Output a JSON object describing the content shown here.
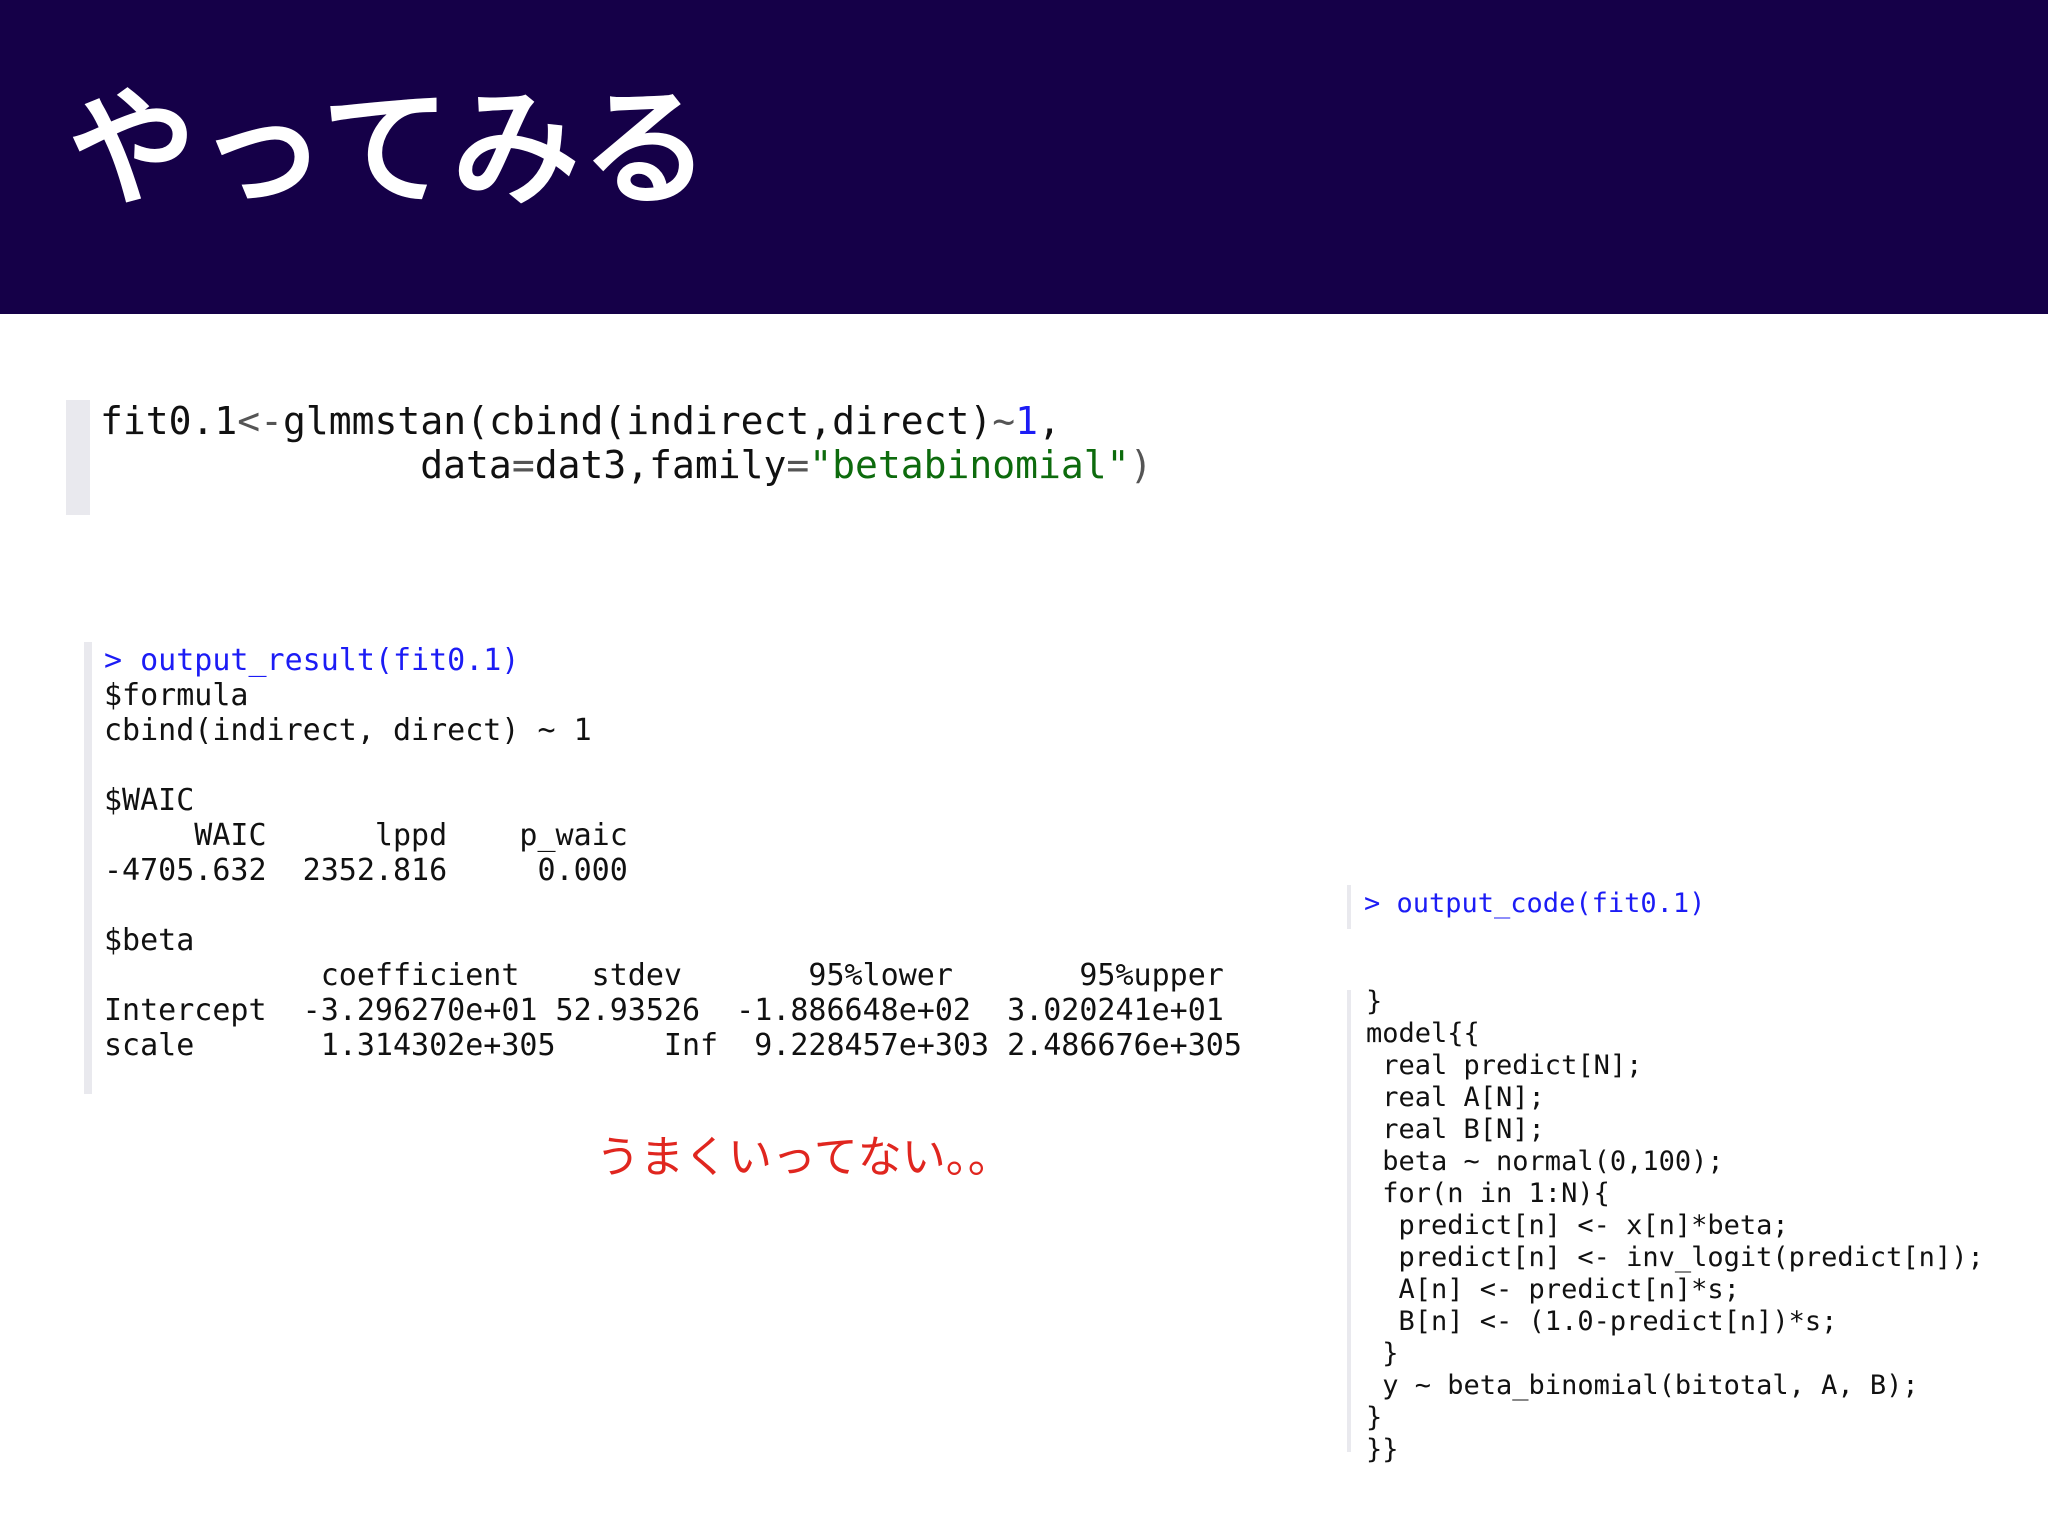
{
  "slide": {
    "title": "やってみる",
    "note": "うまくいってない。。"
  },
  "call": {
    "line1_a": "fit0.1",
    "line1_b": "<-",
    "line1_c": "glmmstan(cbind(indirect,direct)",
    "line1_d": "~",
    "line1_e": "1",
    "line1_f": ",",
    "line2_indent": "              ",
    "line2_a": "data",
    "line2_b": "=",
    "line2_c": "dat3,family",
    "line2_d": "=",
    "line2_e": "\"betabinomial\"",
    "line2_f": ")"
  },
  "output": {
    "prompt": "> output_result(fit0.1)",
    "formula_label": "$formula",
    "formula_value": "cbind(indirect, direct) ~ 1",
    "waic_label": "$WAIC",
    "waic_header": "     WAIC      lppd    p_waic",
    "waic_values": "-4705.632  2352.816     0.000",
    "beta_label": "$beta",
    "beta_header": "            coefficient    stdev       95%lower       95%upper",
    "beta_row1": "Intercept  -3.296270e+01 52.93526  -1.886648e+02  3.020241e+01",
    "beta_row2": "scale       1.314302e+305      Inf  9.228457e+303 2.486676e+305"
  },
  "stan": {
    "prompt": "> output_code(fit0.1)",
    "lines": [
      "}",
      "model{{",
      " real predict[N];",
      " real A[N];",
      " real B[N];",
      " beta ~ normal(0,100);",
      " for(n in 1:N){",
      "  predict[n] <- x[n]*beta;",
      "  predict[n] <- inv_logit(predict[n]);",
      "  A[n] <- predict[n]*s;",
      "  B[n] <- (1.0-predict[n])*s;",
      " }",
      " y ~ beta_binomial(bitotal, A, B);",
      "}",
      "}}"
    ]
  },
  "colors": {
    "header_bg": "#150048",
    "title_text": "#ffffff",
    "prompt_blue": "#1c1cf5",
    "string_green": "#0d6b0d",
    "note_red": "#e0261f"
  }
}
